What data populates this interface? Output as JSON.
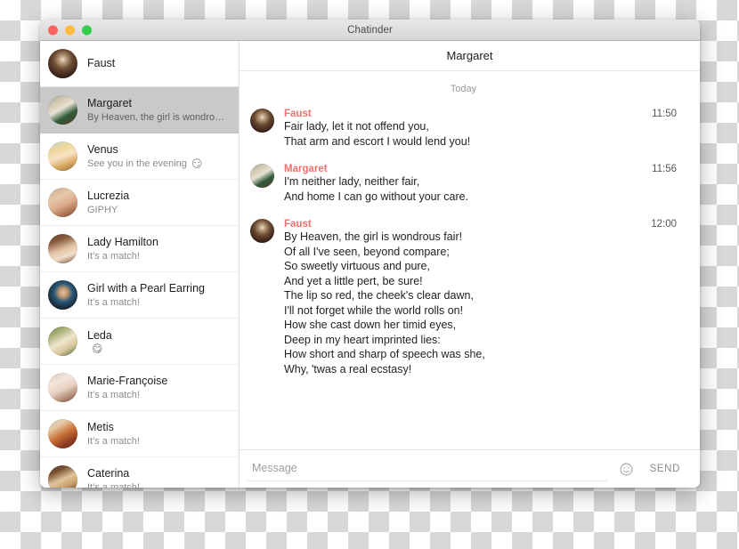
{
  "window": {
    "title": "Chatinder",
    "controls": [
      {
        "name": "close",
        "color": "#fc625d"
      },
      {
        "name": "minimize",
        "color": "#fdbc40"
      },
      {
        "name": "zoom",
        "color": "#35cd4b"
      }
    ]
  },
  "theme": {
    "accent": "#f2706d",
    "selected_row_bg": "#c9c9c9",
    "text_primary": "#1d1d1d",
    "text_secondary": "#8b8b8b"
  },
  "sidebar": {
    "self": {
      "name": "Faust",
      "avatar_name": "avatar-faust"
    },
    "conversations": [
      {
        "name": "Margaret",
        "preview": "By Heaven, the girl is wondro…",
        "emoji": "",
        "selected": true,
        "avatar_name": "avatar-margaret"
      },
      {
        "name": "Venus",
        "preview": "See you in the evening",
        "emoji": "😏",
        "selected": false,
        "avatar_name": "avatar-venus"
      },
      {
        "name": "Lucrezia",
        "preview": "GIPHY",
        "emoji": "",
        "selected": false,
        "avatar_name": "avatar-lucrezia"
      },
      {
        "name": "Lady Hamilton",
        "preview": "It's a match!",
        "emoji": "",
        "selected": false,
        "avatar_name": "avatar-lady-hamilton"
      },
      {
        "name": "Girl with a Pearl Earring",
        "preview": "It's a match!",
        "emoji": "",
        "selected": false,
        "avatar_name": "avatar-girl-with-a-pearl-earring"
      },
      {
        "name": "Leda",
        "preview": "",
        "emoji": "😋",
        "selected": false,
        "avatar_name": "avatar-leda"
      },
      {
        "name": "Marie-Françoise",
        "preview": "It's a match!",
        "emoji": "",
        "selected": false,
        "avatar_name": "avatar-marie-francoise"
      },
      {
        "name": "Metis",
        "preview": "It's a match!",
        "emoji": "",
        "selected": false,
        "avatar_name": "avatar-metis"
      },
      {
        "name": "Caterina",
        "preview": "It's a match!",
        "emoji": "",
        "selected": false,
        "avatar_name": "avatar-caterina"
      }
    ]
  },
  "chat": {
    "title": "Margaret",
    "day_divider": "Today",
    "messages": [
      {
        "sender": "Faust",
        "time": "11:50",
        "avatar_name": "avatar-faust",
        "lines": [
          "Fair lady, let it not offend you,",
          "That arm and escort I would lend you!"
        ]
      },
      {
        "sender": "Margaret",
        "time": "11:56",
        "avatar_name": "avatar-margaret",
        "lines": [
          "I'm neither lady, neither fair,",
          "And home I can go without your care."
        ]
      },
      {
        "sender": "Faust",
        "time": "12:00",
        "avatar_name": "avatar-faust",
        "lines": [
          "By Heaven, the girl is wondrous fair!",
          "Of all I've seen, beyond compare;",
          "So sweetly virtuous and pure,",
          "And yet a little pert, be sure!",
          "The lip so red, the cheek's clear dawn,",
          "I'll not forget while the world rolls on!",
          "How she cast down her timid eyes,",
          "Deep in my heart imprinted lies:",
          "How short and sharp of speech was she,",
          "Why, 'twas a real ecstasy!"
        ]
      }
    ]
  },
  "composer": {
    "placeholder": "Message",
    "value": "",
    "emoji_icon": "smiley-icon",
    "send_label": "SEND"
  }
}
